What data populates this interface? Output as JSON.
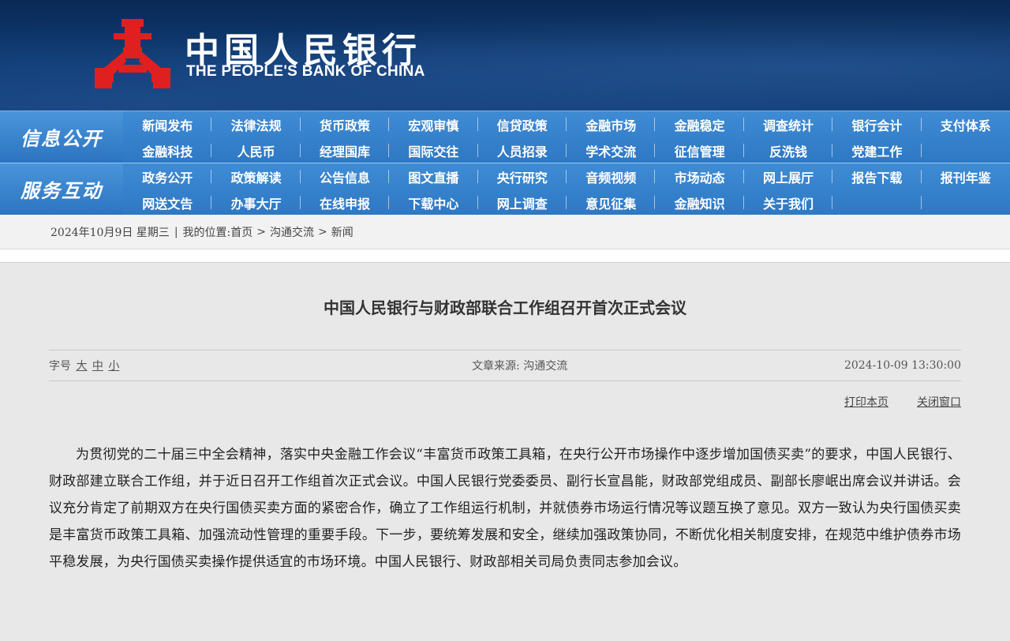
{
  "header": {
    "logo_cn": "中国人民银行",
    "logo_en": "THE PEOPLE'S BANK OF CHINA",
    "logo_color": "#e02020"
  },
  "nav": {
    "info": {
      "title": "信息公开",
      "items": [
        "新闻发布",
        "法律法规",
        "货币政策",
        "宏观审慎",
        "信贷政策",
        "金融市场",
        "金融稳定",
        "调查统计",
        "银行会计",
        "支付体系",
        "金融科技",
        "人民币",
        "经理国库",
        "国际交往",
        "人员招录",
        "学术交流",
        "征信管理",
        "反洗钱",
        "党建工作",
        ""
      ]
    },
    "service": {
      "title": "服务互动",
      "items": [
        "政务公开",
        "政策解读",
        "公告信息",
        "图文直播",
        "央行研究",
        "音频视频",
        "市场动态",
        "网上展厅",
        "报告下载",
        "报刊年鉴",
        "网送文告",
        "办事大厅",
        "在线申报",
        "下载中心",
        "网上调查",
        "意见征集",
        "金融知识",
        "关于我们",
        "",
        ""
      ]
    }
  },
  "breadcrumb": {
    "date": "2024年10月9日 星期三",
    "sep": "|",
    "prefix": "我的位置:",
    "home": "首页",
    "arrow": ">",
    "section": "沟通交流",
    "current": "新闻"
  },
  "article": {
    "title": "中国人民银行与财政部联合工作组召开首次正式会议",
    "font_size_label": "字号",
    "font_sizes": [
      "大",
      "中",
      "小"
    ],
    "source_label": "文章来源:",
    "source": "沟通交流",
    "datetime": "2024-10-09 13:30:00",
    "print_label": "打印本页",
    "close_label": "关闭窗口",
    "body": "为贯彻党的二十届三中全会精神，落实中央金融工作会议“丰富货币政策工具箱，在央行公开市场操作中逐步增加国债买卖”的要求，中国人民银行、财政部建立联合工作组，并于近日召开工作组首次正式会议。中国人民银行党委委员、副行长宣昌能，财政部党组成员、副部长廖岷出席会议并讲话。会议充分肯定了前期双方在央行国债买卖方面的紧密合作，确立了工作组运行机制，并就债券市场运行情况等议题互换了意见。双方一致认为央行国债买卖是丰富货币政策工具箱、加强流动性管理的重要手段。下一步，要统筹发展和安全，继续加强政策协同，不断优化相关制度安排，在规范中维护债券市场平稳发展，为央行国债买卖操作提供适宜的市场环境。中国人民银行、财政部相关司局负责同志参加会议。"
  }
}
